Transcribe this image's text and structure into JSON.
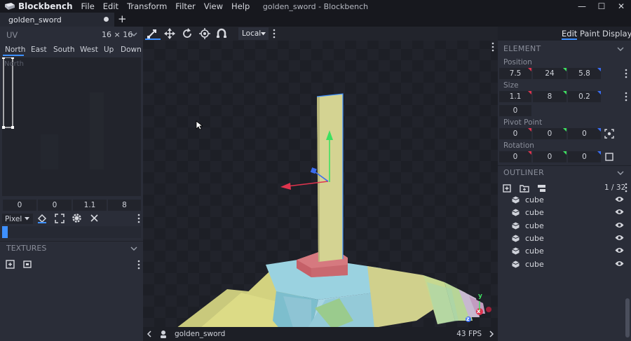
{
  "app": {
    "name": "Blockbench",
    "window_title": "golden_sword - Blockbench"
  },
  "menu": [
    "File",
    "Edit",
    "Transform",
    "Filter",
    "View",
    "Help"
  ],
  "window_controls": {
    "minimize": "—",
    "maximize": "☐",
    "close": "✕"
  },
  "tabs": [
    {
      "label": "golden_sword"
    }
  ],
  "tab_add": "+",
  "uv_panel": {
    "title": "UV",
    "resolution": "16 × 16",
    "faces": [
      "North",
      "East",
      "South",
      "West",
      "Up",
      "Down"
    ],
    "active_face": "North",
    "canvas_label": "North",
    "values": [
      "0",
      "0",
      "1.1",
      "8"
    ],
    "mode": "Pixel"
  },
  "textures_panel": {
    "title": "TEXTURES"
  },
  "viewport": {
    "transform_space": "Local",
    "model_name": "golden_sword",
    "fps": "43 FPS",
    "gizmo_axes": {
      "x": "x",
      "y": "y",
      "z": "z"
    }
  },
  "modes": [
    "Edit",
    "Paint",
    "Display"
  ],
  "active_mode": "Edit",
  "element_panel": {
    "title": "ELEMENT",
    "position": {
      "label": "Position",
      "values": [
        "7.5",
        "24",
        "5.8"
      ]
    },
    "size": {
      "label": "Size",
      "values": [
        "1.1",
        "8",
        "0.2"
      ],
      "inflate": "0"
    },
    "pivot": {
      "label": "Pivot Point",
      "values": [
        "0",
        "0",
        "0"
      ]
    },
    "rotation": {
      "label": "Rotation",
      "values": [
        "0",
        "0",
        "0"
      ]
    }
  },
  "outliner": {
    "title": "OUTLINER",
    "count": "1 / 32",
    "items": [
      "cube",
      "cube",
      "cube",
      "cube",
      "cube",
      "cube"
    ]
  },
  "colors": {
    "accent": "#3e90ff",
    "axis_x": "#e0344e",
    "axis_y": "#3ee060",
    "axis_z": "#3a6cf0"
  }
}
